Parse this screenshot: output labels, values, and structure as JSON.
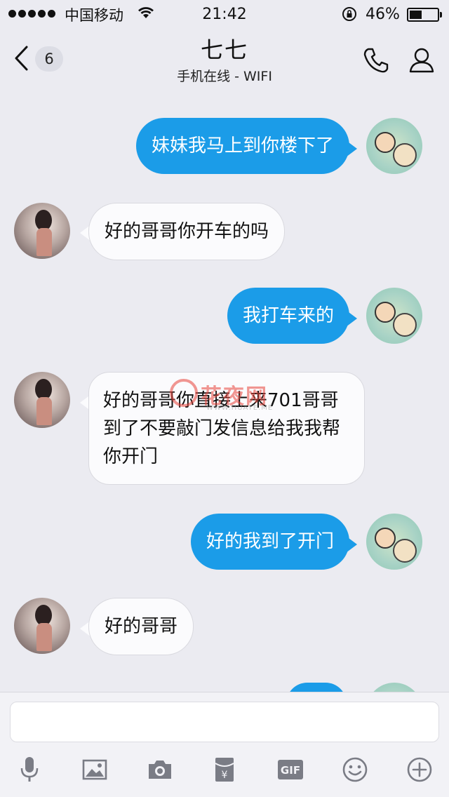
{
  "status_bar": {
    "carrier": "中国移动",
    "time": "21:42",
    "battery_percent": "46%",
    "battery_level": 0.46,
    "signal_dots": 5
  },
  "nav": {
    "back_count": "6",
    "contact_name": "七七",
    "status": "手机在线 - WIFI"
  },
  "messages": [
    {
      "from": "self",
      "text": "妹妹我马上到你楼下了"
    },
    {
      "from": "other",
      "text": "好的哥哥你开车的吗"
    },
    {
      "from": "self",
      "text": "我打车来的"
    },
    {
      "from": "other",
      "text": "好的哥哥你直接上来701哥哥到了不要敲门发信息给我我帮你开门"
    },
    {
      "from": "self",
      "text": "好的我到了开门"
    },
    {
      "from": "other",
      "text": "好的哥哥"
    }
  ],
  "watermark": {
    "text": "花夜网",
    "url": "WWW.HUAYE.ME"
  },
  "input": {
    "placeholder": ""
  },
  "toolbar": {
    "gif_label": "GIF",
    "icons": [
      "microphone-icon",
      "image-icon",
      "camera-icon",
      "red-packet-icon",
      "gif-icon",
      "emoji-icon",
      "plus-icon"
    ]
  },
  "colors": {
    "self_bubble": "#1b9ce8",
    "other_bubble": "#fbfbfd",
    "background": "#ebebf1"
  }
}
